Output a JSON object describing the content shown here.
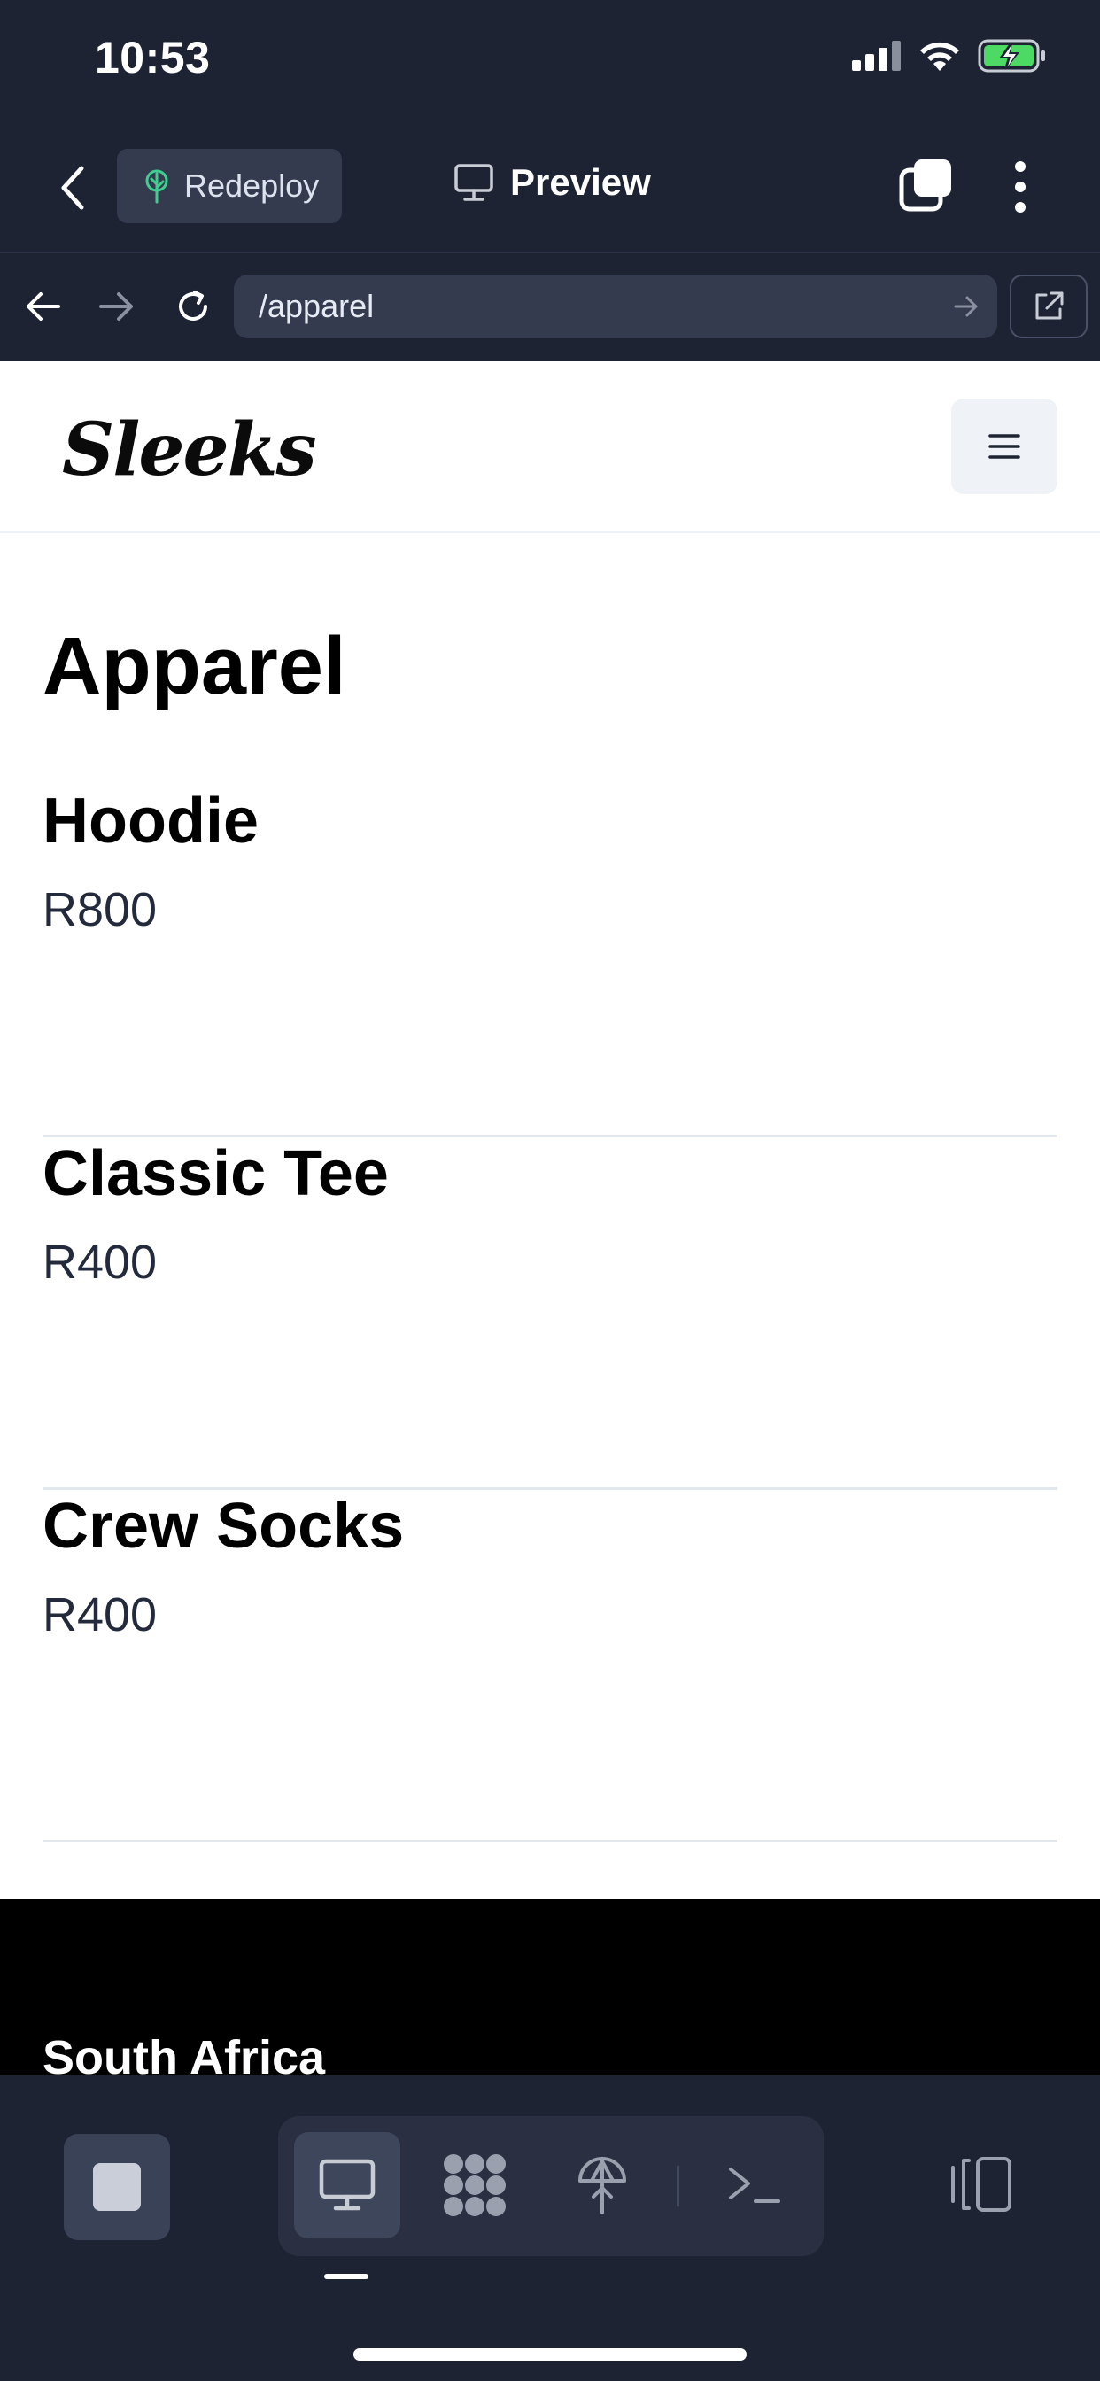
{
  "status_bar": {
    "time": "10:53"
  },
  "app_bar": {
    "redeploy_label": "Redeploy",
    "preview_label": "Preview"
  },
  "browser": {
    "url": "/apparel"
  },
  "site": {
    "logo_text": "Sleeks",
    "page_title": "Apparel",
    "products": [
      {
        "name": "Hoodie",
        "price": "R800"
      },
      {
        "name": "Classic Tee",
        "price": "R400"
      },
      {
        "name": "Crew Socks",
        "price": "R400"
      }
    ],
    "footer_country": "South Africa"
  },
  "bottom_toolbar": {
    "modes": [
      "preview-icon",
      "apps-icon",
      "deploy-icon",
      "terminal-icon"
    ],
    "active_mode": "preview-icon"
  },
  "colors": {
    "chrome_bg": "#1e2333",
    "chrome_button": "#343b4f",
    "accent_green": "#3ecf8e",
    "battery_green": "#4cd964"
  }
}
